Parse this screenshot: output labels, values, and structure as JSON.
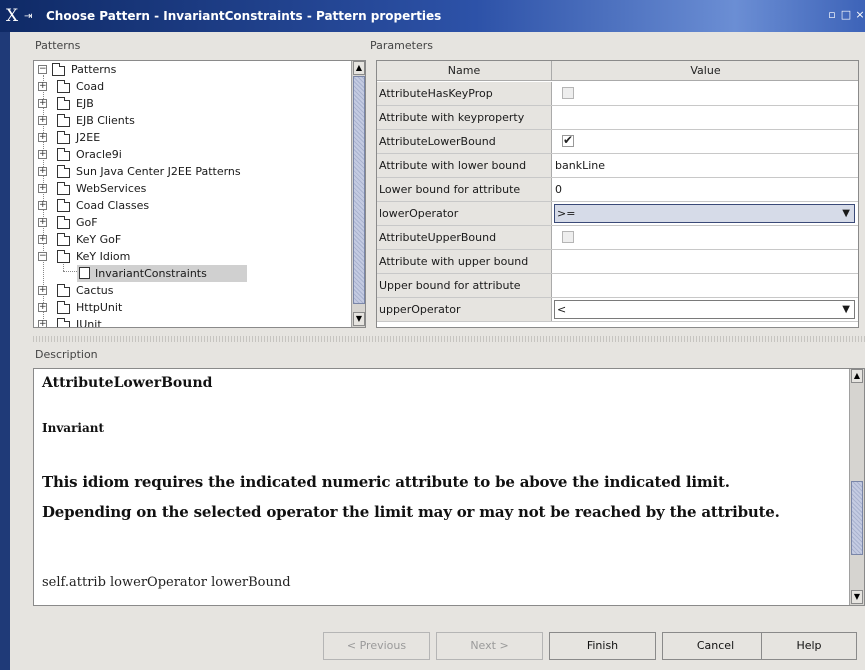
{
  "window": {
    "title": "Choose Pattern - InvariantConstraints - Pattern properties",
    "logo": "X",
    "controls": [
      "minimize-icon",
      "maximize-icon",
      "close-icon"
    ]
  },
  "patterns": {
    "heading": "Patterns",
    "root": "Patterns",
    "items": [
      {
        "label": "Coad",
        "expanded": false
      },
      {
        "label": "EJB",
        "expanded": false
      },
      {
        "label": "EJB Clients",
        "expanded": false
      },
      {
        "label": "J2EE",
        "expanded": false
      },
      {
        "label": "Oracle9i",
        "expanded": false
      },
      {
        "label": "Sun Java Center J2EE Patterns",
        "expanded": false
      },
      {
        "label": "WebServices",
        "expanded": false
      },
      {
        "label": "Coad Classes",
        "expanded": false
      },
      {
        "label": "GoF",
        "expanded": false
      },
      {
        "label": "KeY GoF",
        "expanded": false
      },
      {
        "label": "KeY Idiom",
        "expanded": true
      },
      {
        "label": "Cactus",
        "expanded": false
      },
      {
        "label": "HttpUnit",
        "expanded": false
      },
      {
        "label": "JUnit",
        "expanded": false
      }
    ],
    "selected_child": "InvariantConstraints"
  },
  "parameters": {
    "heading": "Parameters",
    "col_name": "Name",
    "col_value": "Value",
    "rows": [
      {
        "name": "AttributeHasKeyProp",
        "type": "checkbox",
        "checked": false
      },
      {
        "name": "Attribute with keyproperty",
        "type": "text",
        "value": ""
      },
      {
        "name": "AttributeLowerBound",
        "type": "checkbox",
        "checked": true,
        "mark": "✔"
      },
      {
        "name": "Attribute with lower bound",
        "type": "text",
        "value": "bankLine"
      },
      {
        "name": "Lower bound for attribute",
        "type": "text",
        "value": "0"
      },
      {
        "name": "lowerOperator",
        "type": "combo",
        "value": ">="
      },
      {
        "name": "AttributeUpperBound",
        "type": "checkbox",
        "checked": false
      },
      {
        "name": "Attribute with upper bound",
        "type": "text",
        "value": ""
      },
      {
        "name": "Upper bound for attribute",
        "type": "text",
        "value": ""
      },
      {
        "name": "upperOperator",
        "type": "combo",
        "value": "<"
      }
    ]
  },
  "description": {
    "heading": "Description",
    "title": "AttributeLowerBound",
    "subtitle": "Invariant",
    "line1": "This idiom requires the indicated numeric attribute to be above the indicated limit.",
    "line2": "Depending on the selected operator the limit may or may not be reached by the attribute.",
    "code": "self.attrib lowerOperator lowerBound"
  },
  "buttons": {
    "previous": "< Previous",
    "next": "Next >",
    "finish": "Finish",
    "cancel": "Cancel",
    "help": "Help"
  },
  "colors": {
    "titlebar": "#1f3a78",
    "panel": "#e6e4e0",
    "selection": "#d0d0d0"
  }
}
